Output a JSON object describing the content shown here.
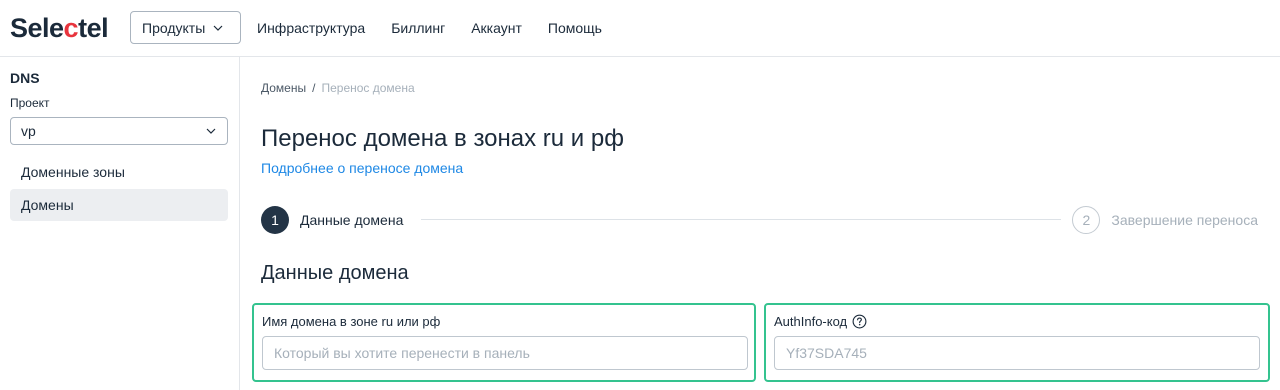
{
  "header": {
    "logo": {
      "part1": "Sele",
      "accent": "c",
      "part2": "tel"
    },
    "products_label": "Продукты",
    "nav": [
      "Инфраструктура",
      "Биллинг",
      "Аккаунт",
      "Помощь"
    ]
  },
  "sidebar": {
    "title": "DNS",
    "project_label": "Проект",
    "project_value": "vp",
    "items": [
      {
        "label": "Доменные зоны",
        "active": false
      },
      {
        "label": "Домены",
        "active": true
      }
    ]
  },
  "breadcrumb": {
    "root": "Домены",
    "separator": "/",
    "current": "Перенос домена"
  },
  "page": {
    "title": "Перенос домена в зонах ru и рф",
    "more_link": "Подробнее о переносе домена"
  },
  "stepper": {
    "steps": [
      {
        "number": "1",
        "label": "Данные домена",
        "state": "active"
      },
      {
        "number": "2",
        "label": "Завершение переноса",
        "state": "pending"
      }
    ]
  },
  "form": {
    "section_title": "Данные домена",
    "domain_field": {
      "label": "Имя домена в зоне ru или рф",
      "placeholder": "Который вы хотите перенести в панель",
      "value": ""
    },
    "authinfo_field": {
      "label": "AuthInfo-код",
      "placeholder": "Yf37SDA745",
      "value": ""
    }
  },
  "colors": {
    "accent_red": "#e8343d",
    "link_blue": "#1e88e5",
    "focus_green": "#34c38f",
    "step_active": "#233446"
  },
  "icons": {
    "products_chevron": "chevron-down-icon",
    "project_chevron": "chevron-down-icon",
    "authinfo_help": "question-circle-icon"
  }
}
